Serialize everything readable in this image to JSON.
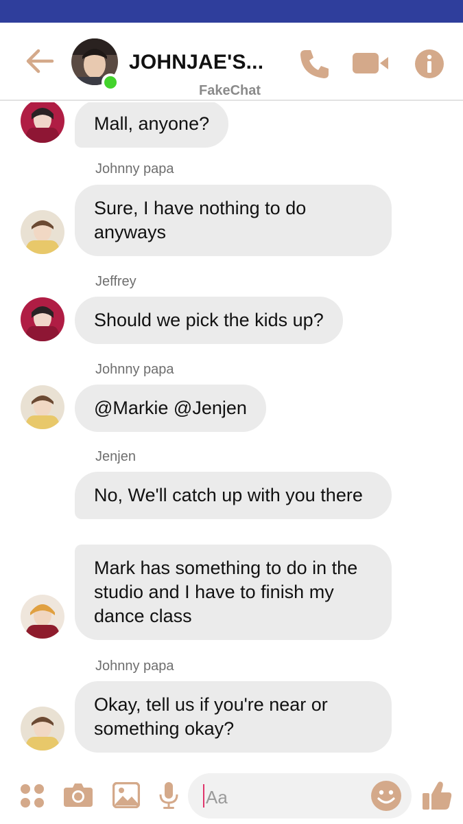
{
  "header": {
    "title": "JOHNJAE'S...",
    "subtitle": "FakeChat",
    "icons": [
      "back-arrow-icon",
      "phone-icon",
      "video-camera-icon",
      "info-icon"
    ]
  },
  "messages": [
    {
      "sender": "",
      "text": "Mall, anyone?"
    },
    {
      "sender": "Johnny papa",
      "text": "Sure, I have nothing to do anyways"
    },
    {
      "sender": "Jeffrey",
      "text": "Should we pick the kids up?"
    },
    {
      "sender": "Johnny papa",
      "text": "@Markie @Jenjen"
    },
    {
      "sender": "Jenjen",
      "text": "No, We'll catch up with you there"
    },
    {
      "sender": "",
      "text": "Mark has something to do in the studio and I have to finish my dance class"
    },
    {
      "sender": "Johnny papa",
      "text": "Okay, tell us if you're near or something okay?"
    }
  ],
  "composer": {
    "placeholder": "Aa",
    "icons": [
      "apps-icon",
      "camera-icon",
      "gallery-icon",
      "microphone-icon",
      "emoji-icon",
      "thumbs-up-icon"
    ]
  },
  "colors": {
    "accent": "#d4a98a",
    "status_bar": "#2f3e9c",
    "bubble": "#ebebeb",
    "online": "#43d32c"
  }
}
